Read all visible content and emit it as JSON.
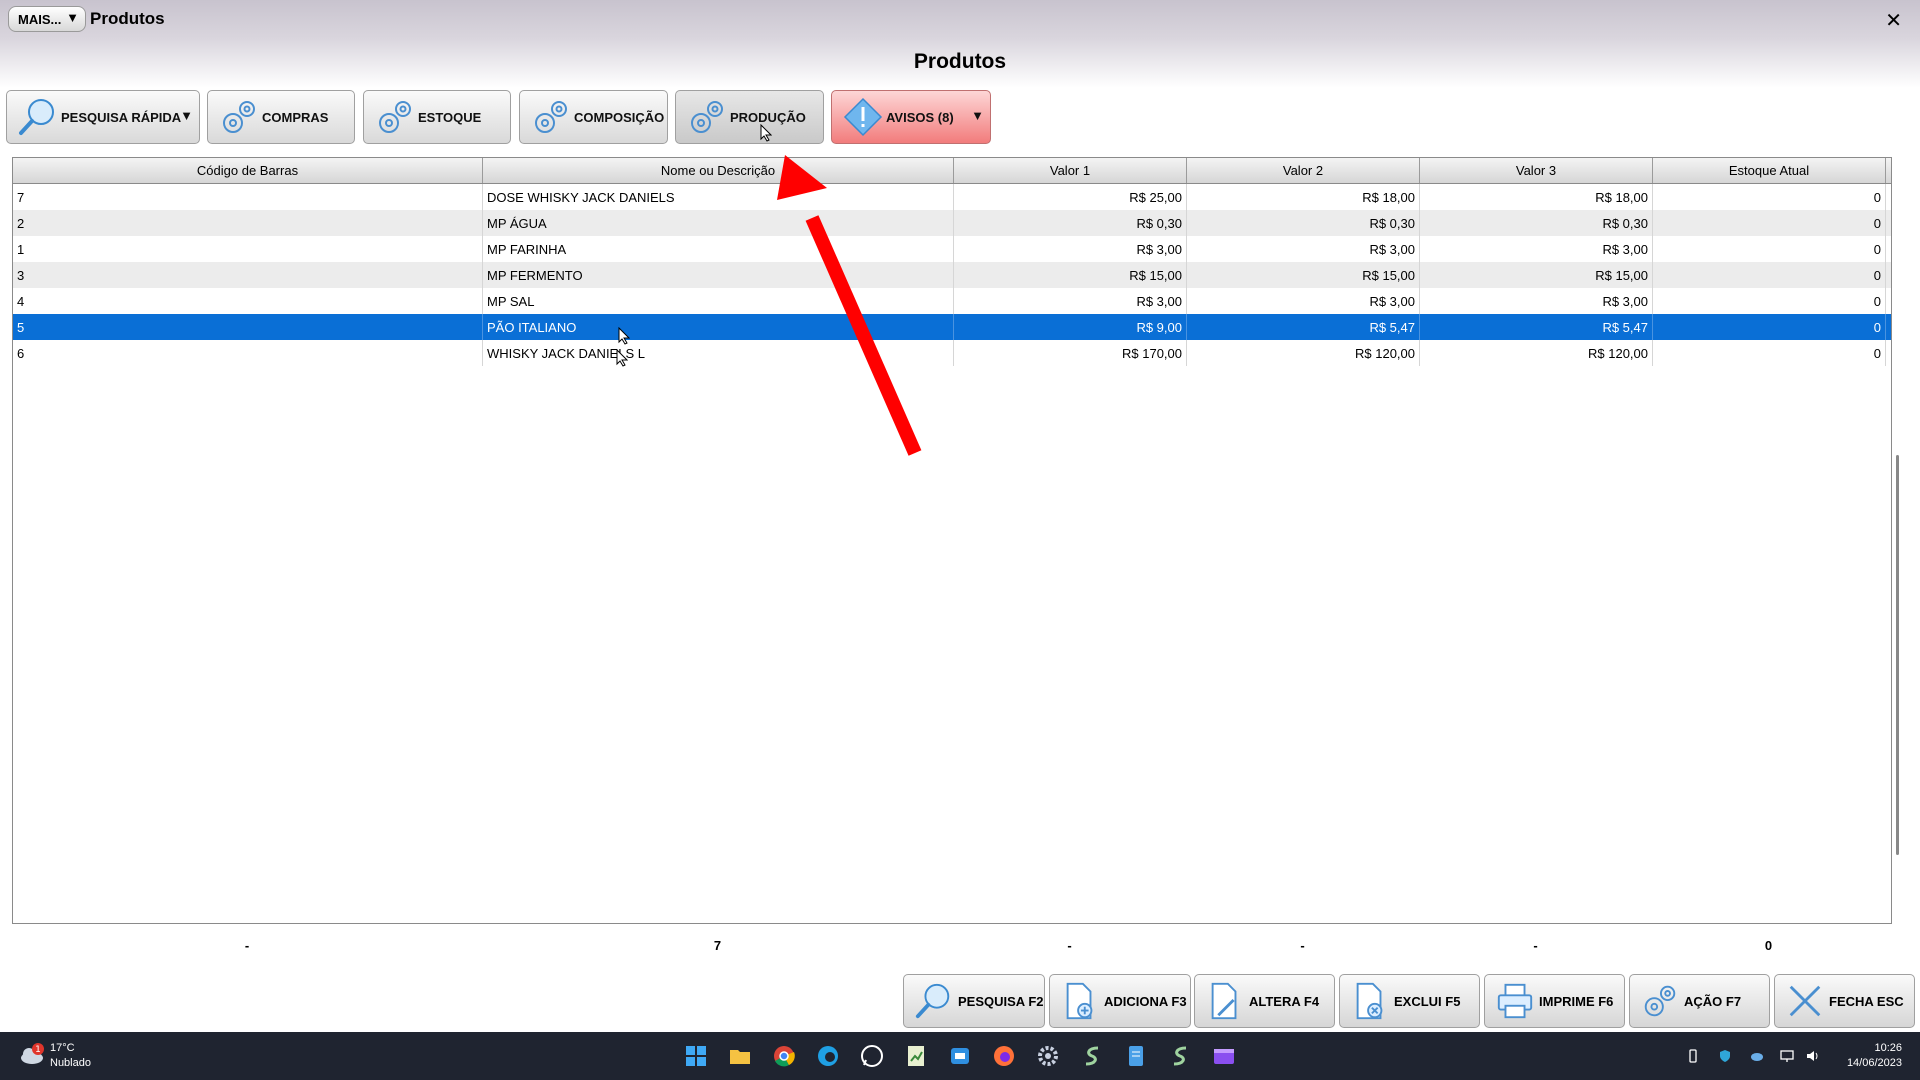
{
  "window": {
    "menu_button": "MAIS...",
    "title": "Produtos",
    "close": "✕"
  },
  "page_title": "Produtos",
  "toolbar": {
    "pesquisa_rapida": "PESQUISA RÁPIDA",
    "compras": "COMPRAS",
    "estoque": "ESTOQUE",
    "composicao": "COMPOSIÇÃO",
    "producao": "PRODUÇÃO",
    "avisos": "AVISOS (8)"
  },
  "grid": {
    "columns": [
      "Código de Barras",
      "Nome ou Descrição",
      "Valor 1",
      "Valor 2",
      "Valor 3",
      "Estoque Atual"
    ],
    "rows": [
      [
        "7",
        "DOSE WHISKY JACK DANIELS",
        "R$ 25,00",
        "R$ 18,00",
        "R$ 18,00",
        "0"
      ],
      [
        "2",
        "MP ÁGUA",
        "R$ 0,30",
        "R$ 0,30",
        "R$ 0,30",
        "0"
      ],
      [
        "1",
        "MP FARINHA",
        "R$ 3,00",
        "R$ 3,00",
        "R$ 3,00",
        "0"
      ],
      [
        "3",
        "MP FERMENTO",
        "R$ 15,00",
        "R$ 15,00",
        "R$ 15,00",
        "0"
      ],
      [
        "4",
        "MP SAL",
        "R$ 3,00",
        "R$ 3,00",
        "R$ 3,00",
        "0"
      ],
      [
        "5",
        "PÃO ITALIANO",
        "R$ 9,00",
        "R$ 5,47",
        "R$ 5,47",
        "0"
      ],
      [
        "6",
        "WHISKY JACK DANIELS L",
        "R$ 170,00",
        "R$ 120,00",
        "R$ 120,00",
        "0"
      ]
    ],
    "selected_row": 5
  },
  "totals": [
    "-",
    "7",
    "-",
    "-",
    "-",
    "0"
  ],
  "actions": {
    "pesquisa": "PESQUISA F2",
    "adiciona": "ADICIONA F3",
    "altera": "ALTERA F4",
    "exclui": "EXCLUI F5",
    "imprime": "IMPRIME F6",
    "acao": "AÇÃO F7",
    "fecha": "FECHA ESC"
  },
  "taskbar": {
    "weather_temp": "17°C",
    "weather_desc": "Nublado",
    "weather_badge": "1",
    "time": "10:26",
    "date": "14/06/2023"
  },
  "colors": {
    "selection": "#0a6fd6",
    "arrow": "#ff0000",
    "avisos": "#f27c7c",
    "taskbar": "#1f2430"
  }
}
